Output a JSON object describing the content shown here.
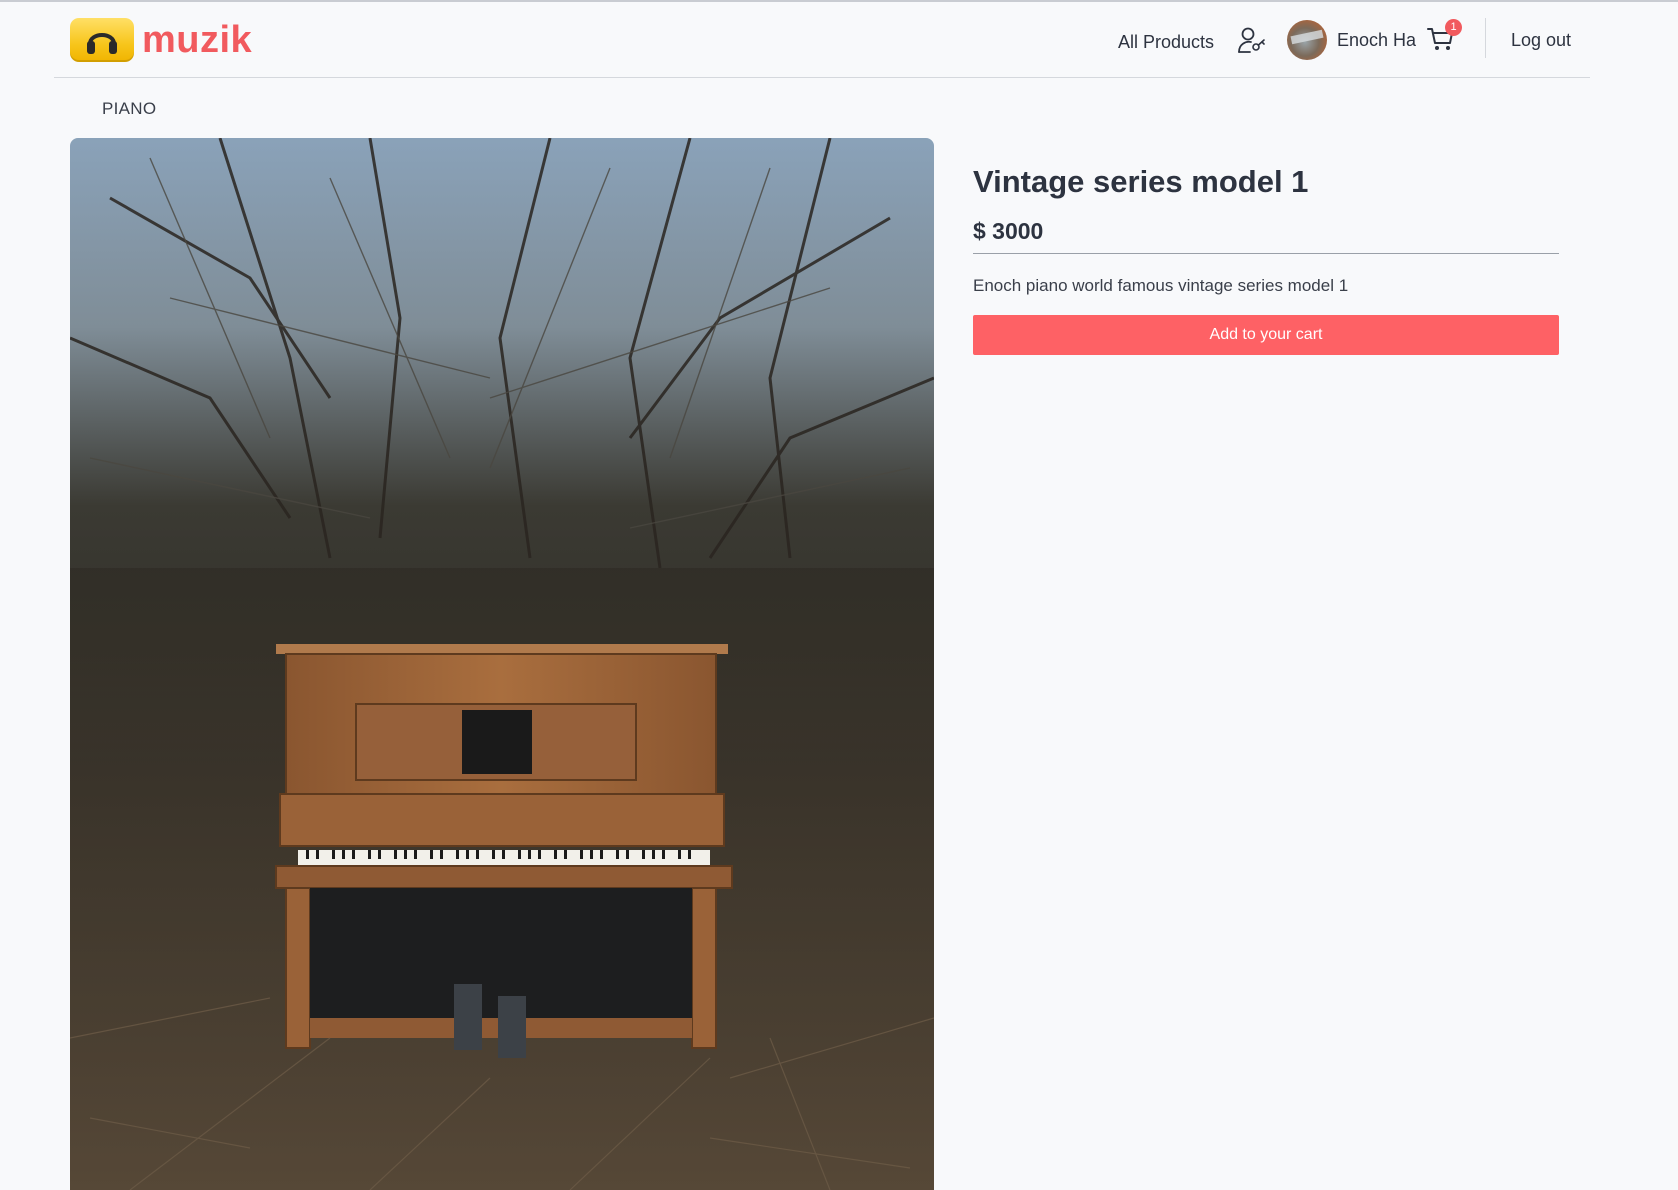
{
  "header": {
    "logo_text": "muzik",
    "nav_all_products": "All Products",
    "user_name": "Enoch Ha",
    "cart_count": "1",
    "logout": "Log out"
  },
  "breadcrumb": "PIANO",
  "product": {
    "title": "Vintage series model 1",
    "price": "$ 3000",
    "description": "Enoch piano world famous vintage series model 1",
    "add_to_cart": "Add to your cart"
  },
  "colors": {
    "accent": "#fe6165",
    "logo_text": "#f15a5e",
    "logo_badge": "#f7c51b",
    "background": "#f8f9fb",
    "text": "#2d3340"
  },
  "icons": [
    "headphones-icon",
    "user-settings-icon",
    "cart-icon"
  ]
}
